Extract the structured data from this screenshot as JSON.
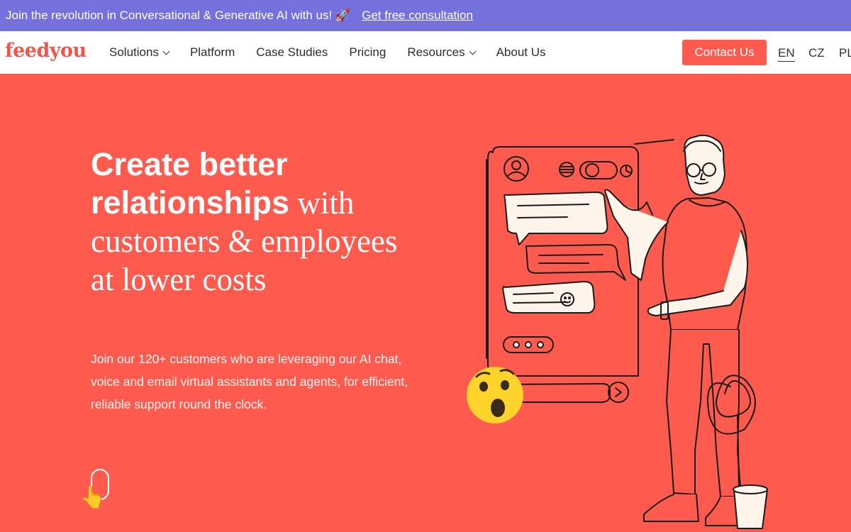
{
  "promo": {
    "text": "Join the revolution in Conversational & Generative AI with us! 🚀",
    "link": "Get free consultation"
  },
  "nav": {
    "logo": "feedyou",
    "items": [
      {
        "label": "Solutions",
        "dropdown": true
      },
      {
        "label": "Platform",
        "dropdown": false
      },
      {
        "label": "Case Studies",
        "dropdown": false
      },
      {
        "label": "Pricing",
        "dropdown": false
      },
      {
        "label": "Resources",
        "dropdown": true
      },
      {
        "label": "About Us",
        "dropdown": false
      }
    ],
    "cta": "Contact Us",
    "languages": [
      "EN",
      "CZ",
      "PL"
    ],
    "active_language": "EN"
  },
  "hero": {
    "title_bold_1": "Create better",
    "title_bold_2": "relationships",
    "title_serif_2": " with",
    "title_serif_3": "customers & employees",
    "title_serif_4": "at lower costs",
    "subtitle": "Join our 120+ customers who are leveraging our AI chat, voice and email virtual assistants and agents, for efficient, reliable support round the clock."
  },
  "icons": {
    "scroll": "scroll-mouse-icon",
    "hand": "pointing-hand-emoji",
    "hand_glyph": "👆",
    "surprised": "surprised-face-emoji"
  },
  "colors": {
    "promo_bg": "#7470de",
    "hero_bg": "#fe5b4e",
    "brand": "#f0574a",
    "emoji_yellow": "#ffd42a"
  }
}
